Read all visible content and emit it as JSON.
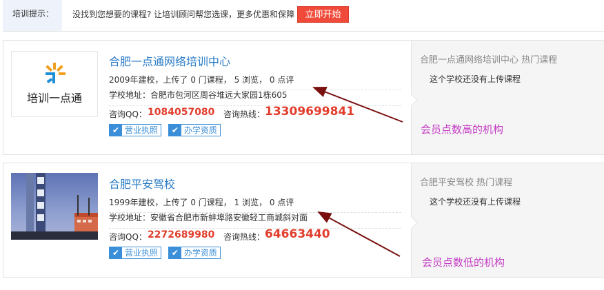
{
  "tipbar": {
    "label": "培训提示：",
    "text": "没找到您想要的课程? 让培训顾问帮您选课，更多优惠和保障",
    "button": "立即开始"
  },
  "schools": [
    {
      "name": "合肥一点通网络培训中心",
      "logo_text": "培训一点通",
      "stats": "2009年建校，上传了 0 门课程， 5 浏览， 0 点评",
      "address": "学校地址：合肥市包河区周谷堆远大家园1栋605",
      "qq_label": "咨询QQ：",
      "qq": "1084057080",
      "hotline_label": "咨询热线：",
      "hotline": "13309699841",
      "badge1": "营业执照",
      "badge2": "办学资质",
      "side_title": "合肥一点通网络培训中心 热门课程",
      "side_empty": "这个学校还没有上传课程",
      "annotation": "会员点数高的机构"
    },
    {
      "name": "合肥平安驾校",
      "stats": "1999年建校，上传了 0 门课程， 1 浏览， 0 点评",
      "address": "学校地址：安徽省合肥市新蚌埠路安徽轻工商城斜对面",
      "qq_label": "咨询QQ：",
      "qq": "2272689980",
      "hotline_label": "咨询热线：",
      "hotline": "64663440",
      "badge1": "营业执照",
      "badge2": "办学资质",
      "side_title": "合肥平安驾校 热门课程",
      "side_empty": "这个学校还没有上传课程",
      "annotation": "会员点数低的机构"
    }
  ],
  "colors": {
    "link": "#2a7cc7",
    "accent_red": "#e23d2c",
    "button_red": "#f04b3a",
    "badge_blue": "#3b8fd9",
    "annotation_magenta": "#c43bc4",
    "arrow_dark_red": "#7a1010"
  }
}
